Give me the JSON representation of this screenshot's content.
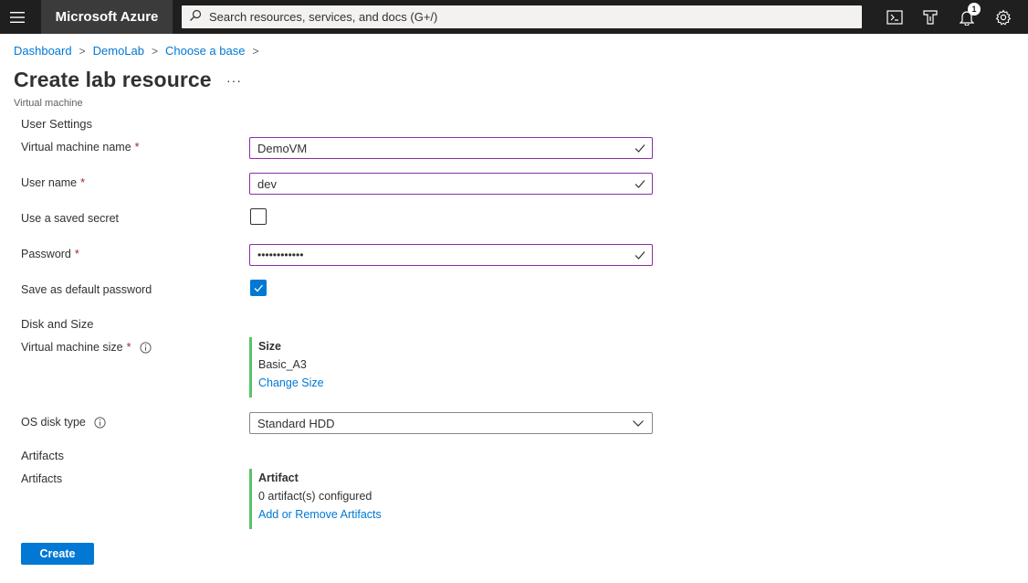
{
  "topbar": {
    "brand": "Microsoft Azure",
    "search_placeholder": "Search resources, services, and docs (G+/)",
    "notification_count": "1",
    "icons": [
      "hamburger-menu-icon",
      "search-icon",
      "cloud-shell-icon",
      "directory-filter-icon",
      "notifications-bell-icon",
      "settings-gear-icon"
    ]
  },
  "breadcrumb": {
    "items": [
      "Dashboard",
      "DemoLab",
      "Choose a base"
    ],
    "separator": ">"
  },
  "header": {
    "title": "Create lab resource",
    "more": "···",
    "subtitle": "Virtual machine"
  },
  "user_settings": {
    "section_title": "User Settings",
    "vm_name_label": "Virtual machine name",
    "vm_name_value": "DemoVM",
    "username_label": "User name",
    "username_value": "dev",
    "saved_secret_label": "Use a saved secret",
    "saved_secret_checked": false,
    "password_label": "Password",
    "password_value": "••••••••••••",
    "save_default_label": "Save as default password",
    "save_default_checked": true,
    "required_marker": "*"
  },
  "disk_and_size": {
    "section_title": "Disk and Size",
    "vm_size_label": "Virtual machine size",
    "size_card_title": "Size",
    "size_value": "Basic_A3",
    "size_link": "Change Size",
    "os_disk_label": "OS disk type",
    "os_disk_value": "Standard HDD"
  },
  "artifacts": {
    "section_title": "Artifacts",
    "label": "Artifacts",
    "card_title": "Artifact",
    "card_value": "0 artifact(s) configured",
    "card_link": "Add or Remove Artifacts"
  },
  "actions": {
    "create_label": "Create"
  },
  "colors": {
    "topbar_bg": "#1f1f1f",
    "brand_bg": "#3b3b3b",
    "accent": "#0078d4",
    "valid_border": "#8a2da5",
    "card_border": "#57c469",
    "required": "#a4262c"
  }
}
